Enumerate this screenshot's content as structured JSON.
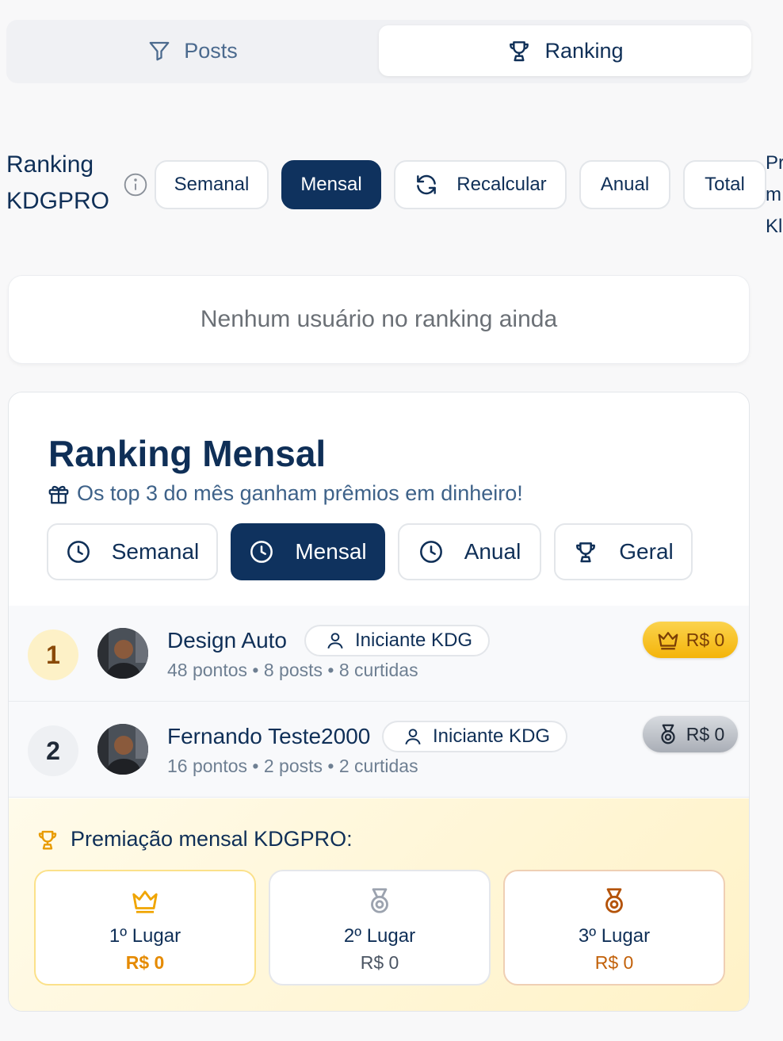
{
  "tabs": [
    {
      "label": "Posts",
      "icon": "filter-icon",
      "active": false
    },
    {
      "label": "Ranking",
      "icon": "trophy-icon",
      "active": true
    }
  ],
  "filter": {
    "title_line1": "Ranking",
    "title_line2": "KDGPRO",
    "buttons": [
      {
        "label": "Semanal",
        "active": false
      },
      {
        "label": "Mensal",
        "active": true
      },
      {
        "label": "Recalcular",
        "icon": "refresh-icon",
        "active": false
      },
      {
        "label": "Anual",
        "active": false
      },
      {
        "label": "Total",
        "active": false
      }
    ],
    "cut_text": "Pr m Kl"
  },
  "empty_message": "Nenhum usuário no ranking ainda",
  "monthly": {
    "title": "Ranking Mensal",
    "subtitle": "Os top 3 do mês ganham prêmios em dinheiro!",
    "period_tabs": [
      {
        "label": "Semanal",
        "icon": "clock-icon",
        "active": false
      },
      {
        "label": "Mensal",
        "icon": "clock-icon",
        "active": true
      },
      {
        "label": "Anual",
        "icon": "clock-icon",
        "active": false
      },
      {
        "label": "Geral",
        "icon": "trophy-icon",
        "active": false
      }
    ],
    "entries": [
      {
        "rank": "1",
        "name": "Design Auto",
        "level": "Iniciante KDG",
        "stats": "48 pontos • 8 posts • 8 curtidas",
        "prize": "R$ 0",
        "prize_icon": "crown-icon"
      },
      {
        "rank": "2",
        "name": "Fernando Teste2000",
        "level": "Iniciante KDG",
        "stats": "16 pontos • 2 posts • 2 curtidas",
        "prize": "R$ 0",
        "prize_icon": "medal-icon"
      }
    ],
    "prizes": {
      "title": "Premiação mensal KDGPRO:",
      "places": [
        {
          "label": "1º Lugar",
          "value": "R$ 0",
          "icon": "crown-icon"
        },
        {
          "label": "2º Lugar",
          "value": "R$ 0",
          "icon": "medal-icon"
        },
        {
          "label": "3º Lugar",
          "value": "R$ 0",
          "icon": "medal-icon"
        }
      ]
    }
  },
  "colors": {
    "primary": "#0f325e",
    "gold": "#f0a500",
    "silver": "#9ca3af",
    "bronze": "#b45309"
  }
}
